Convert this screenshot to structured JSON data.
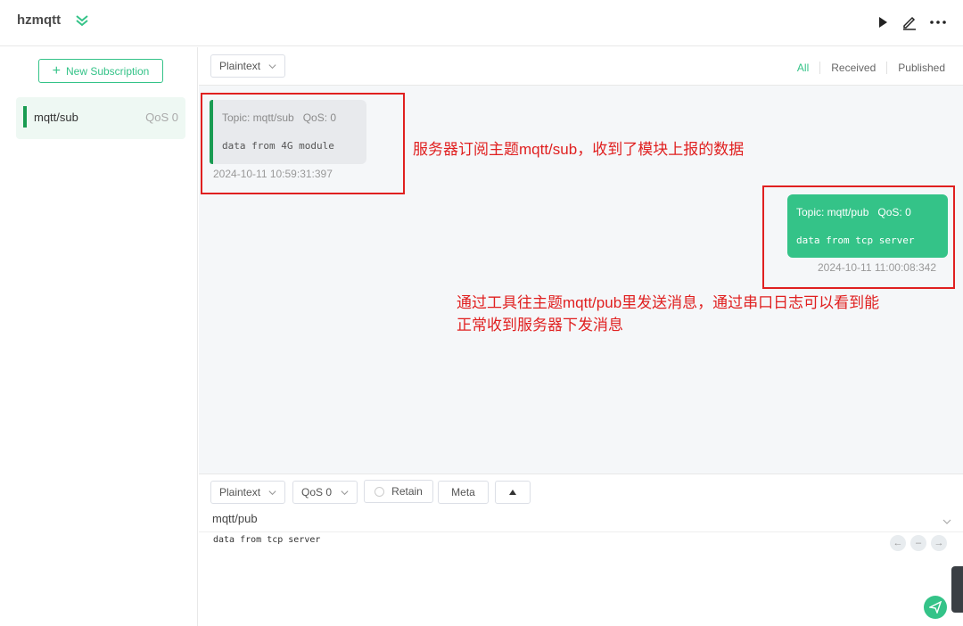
{
  "header": {
    "connection_name": "hzmqtt",
    "icons": [
      "chevron-double-down-icon",
      "play-icon",
      "edit-icon",
      "more-icon"
    ]
  },
  "sidebar": {
    "new_subscription_label": "New Subscription",
    "subscriptions": [
      {
        "topic": "mqtt/sub",
        "qos": "QoS 0",
        "color": "#1a9c52"
      }
    ]
  },
  "toolbar": {
    "format": "Plaintext",
    "filters": [
      "All",
      "Received",
      "Published"
    ],
    "active_filter": "All"
  },
  "messages": [
    {
      "direction": "received",
      "topic_label": "Topic: mqtt/sub",
      "qos_label": "QoS: 0",
      "payload": "data from 4G module",
      "time": "2024-10-11 10:59:31:397"
    },
    {
      "direction": "published",
      "topic_label": "Topic: mqtt/pub",
      "qos_label": "QoS: 0",
      "payload": "data from tcp server",
      "time": "2024-10-11 11:00:08:342"
    }
  ],
  "annotations": [
    "服务器订阅主题mqtt/sub，收到了模块上报的数据",
    "通过工具往主题mqtt/pub里发送消息，通过串口日志可以看到能",
    "正常收到服务器下发消息"
  ],
  "composer": {
    "format": "Plaintext",
    "qos": "QoS 0",
    "retain_label": "Retain",
    "meta_label": "Meta",
    "topic": "mqtt/pub",
    "payload": "data from tcp server"
  },
  "colors": {
    "accent": "#34c388",
    "subscription_bar": "#1a9c52",
    "annotation": "#e02020"
  }
}
